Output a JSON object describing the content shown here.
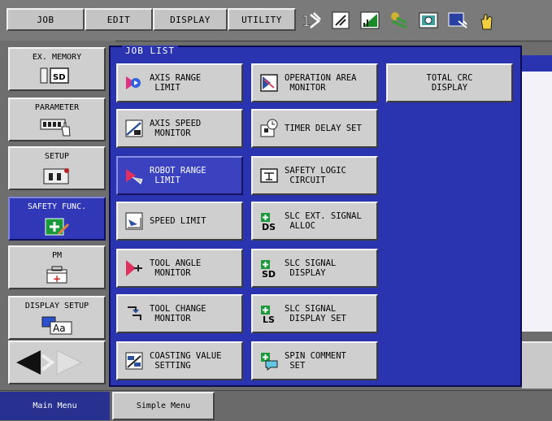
{
  "topmenu": {
    "job": "JOB",
    "edit": "EDIT",
    "display": "DISPLAY",
    "utility": "UTILITY"
  },
  "toolbar_icons": [
    "interlock-icon",
    "edit-check-icon",
    "signal-icon",
    "teach-icon",
    "camera-icon",
    "monitor-icon",
    "hand-icon"
  ],
  "sidebar": {
    "items": [
      {
        "label": "EX. MEMORY",
        "icon": "sd-card-icon"
      },
      {
        "label": "PARAMETER",
        "icon": "parameter-icon"
      },
      {
        "label": "SETUP",
        "icon": "setup-icon"
      },
      {
        "label": "SAFETY FUNC.",
        "icon": "safety-icon",
        "selected": true
      },
      {
        "label": "PM",
        "icon": "pm-icon"
      },
      {
        "label": "DISPLAY SETUP",
        "icon": "display-setup-icon"
      }
    ]
  },
  "main": {
    "list_title": "JOB LIST",
    "buttons": [
      {
        "label": "AXIS RANGE\n LIMIT",
        "icon": "axis-range-icon"
      },
      {
        "label": "OPERATION AREA\n MONITOR",
        "icon": "operation-area-icon"
      },
      {
        "label": "TOTAL CRC\nDISPLAY",
        "icon": ""
      },
      {
        "label": "AXIS SPEED\n MONITOR",
        "icon": "axis-speed-icon"
      },
      {
        "label": "TIMER DELAY SET",
        "icon": "timer-icon"
      },
      {
        "label": "ROBOT RANGE\n LIMIT",
        "icon": "robot-range-icon",
        "selected": true
      },
      {
        "label": "SAFETY LOGIC\n CIRCUIT",
        "icon": "logic-circuit-icon"
      },
      {
        "label": "SPEED LIMIT",
        "icon": "speed-limit-icon"
      },
      {
        "label": "SLC EXT. SIGNAL\n ALLOC",
        "icon": "slc-ds-icon"
      },
      {
        "label": "TOOL ANGLE\n MONITOR",
        "icon": "tool-angle-icon"
      },
      {
        "label": "SLC SIGNAL\n DISPLAY",
        "icon": "slc-sd-icon"
      },
      {
        "label": "TOOL CHANGE\n MONITOR",
        "icon": "tool-change-icon"
      },
      {
        "label": "SLC SIGNAL\n DISPLAY SET",
        "icon": "slc-ls-icon"
      },
      {
        "label": "COASTING VALUE\n SETTING",
        "icon": "coasting-icon"
      },
      {
        "label": "SPIN COMMENT\n SET",
        "icon": "spin-comment-icon"
      }
    ]
  },
  "bottom_tabs": {
    "main_menu": "Main Menu",
    "simple_menu": "Simple Menu"
  },
  "icon_text": {
    "sd": "SD",
    "aa": "Aa",
    "pm_plus": "+",
    "ds": "DS",
    "sd2": "SD",
    "ls": "LS"
  }
}
